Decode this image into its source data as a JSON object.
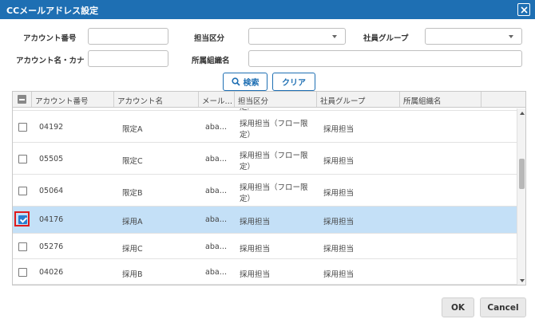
{
  "dialog": {
    "title": "CCメールアドレス設定"
  },
  "filters": {
    "account_no_label": "アカウント番号",
    "tanto_kubun_label": "担当区分",
    "employee_group_label": "社員グループ",
    "account_name_label": "アカウント名・カナ",
    "department_label": "所属組織名",
    "account_no_value": "",
    "account_name_value": "",
    "department_value": ""
  },
  "buttons": {
    "search": "検索",
    "clear": "クリア",
    "ok": "OK",
    "cancel": "Cancel"
  },
  "grid": {
    "columns": [
      "アカウント番号",
      "アカウント名",
      "メール…",
      "担当区分",
      "社員グループ",
      "所属組織名"
    ],
    "partial_top_text": "定）",
    "rows": [
      {
        "account_no": "04192",
        "name": "限定A",
        "mail": "aba…",
        "kubun_1": "採用担当（フロー限",
        "kubun_2": "定）",
        "group": "採用担当",
        "checked": false,
        "selected": false
      },
      {
        "account_no": "05505",
        "name": "限定C",
        "mail": "aba…",
        "kubun_1": "採用担当（フロー限",
        "kubun_2": "定）",
        "group": "採用担当",
        "checked": false,
        "selected": false
      },
      {
        "account_no": "05064",
        "name": "限定B",
        "mail": "aba…",
        "kubun_1": "採用担当（フロー限",
        "kubun_2": "定）",
        "group": "採用担当",
        "checked": false,
        "selected": false
      },
      {
        "account_no": "04176",
        "name": "採用A",
        "mail": "aba…",
        "kubun_1": "採用担当",
        "kubun_2": "",
        "group": "採用担当",
        "checked": true,
        "selected": true
      },
      {
        "account_no": "05276",
        "name": "採用C",
        "mail": "aba…",
        "kubun_1": "採用担当",
        "kubun_2": "",
        "group": "採用担当",
        "checked": false,
        "selected": false
      },
      {
        "account_no": "04026",
        "name": "採用B",
        "mail": "aba…",
        "kubun_1": "採用担当",
        "kubun_2": "",
        "group": "採用担当",
        "checked": false,
        "selected": false
      }
    ]
  },
  "colors": {
    "titlebar": "#1e6fb3",
    "selected_row": "#c4e0f7",
    "highlight": "#e01b1b"
  }
}
